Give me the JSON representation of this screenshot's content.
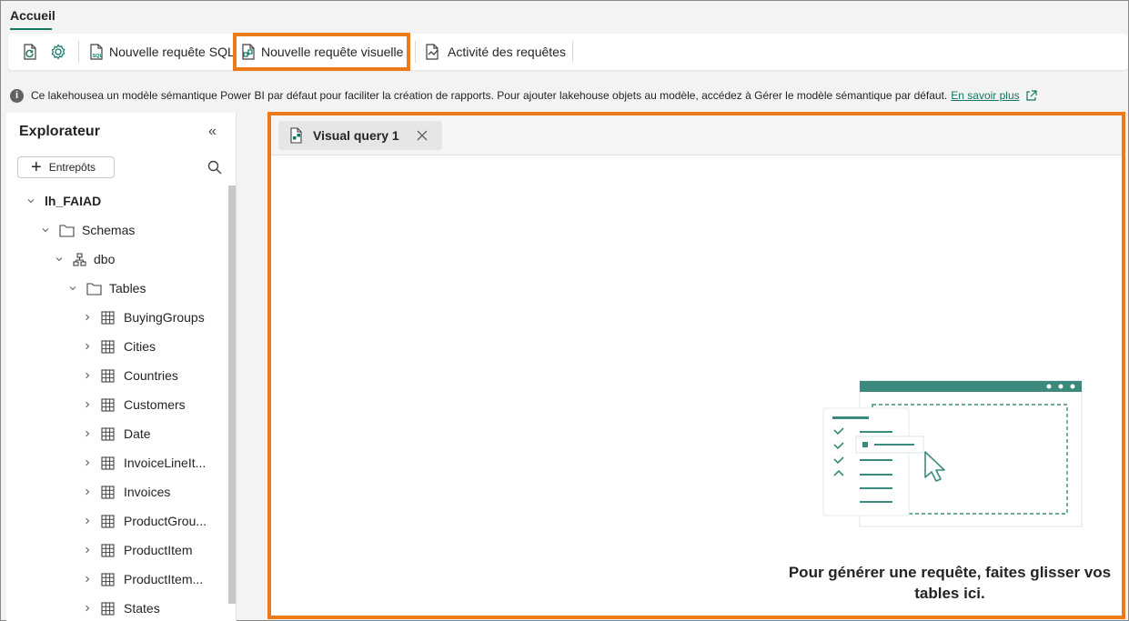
{
  "ribbon": {
    "active_tab": "Accueil"
  },
  "toolbar": {
    "refresh_icon": "refresh-icon",
    "settings_icon": "settings-gear-icon",
    "new_sql_query": "Nouvelle requête SQL",
    "new_visual_query": "Nouvelle requête visuelle",
    "query_activity": "Activité des requêtes"
  },
  "infobar": {
    "message": "Ce lakehousea un modèle sémantique Power BI par défaut pour faciliter la création de rapports. Pour ajouter lakehouse objets au modèle, accédez à Gérer le modèle sémantique par défaut.",
    "link": "En savoir plus"
  },
  "explorer": {
    "title": "Explorateur",
    "add_button": "Entrepôts",
    "tree": {
      "root": "lh_FAIAD",
      "schemas": "Schemas",
      "schema": "dbo",
      "tables_folder": "Tables",
      "tables": [
        "BuyingGroups",
        "Cities",
        "Countries",
        "Customers",
        "Date",
        "InvoiceLineIt...",
        "Invoices",
        "ProductGrou...",
        "ProductItem",
        "ProductItem...",
        "States"
      ]
    }
  },
  "editor": {
    "tab_label": "Visual query 1",
    "empty_line1": "Pour générer une requête, faites glisser vos",
    "empty_line2": "tables ici."
  },
  "colors": {
    "accent": "#117865",
    "highlight": "#ee7b1a",
    "illustration": "#3c8a7e"
  }
}
